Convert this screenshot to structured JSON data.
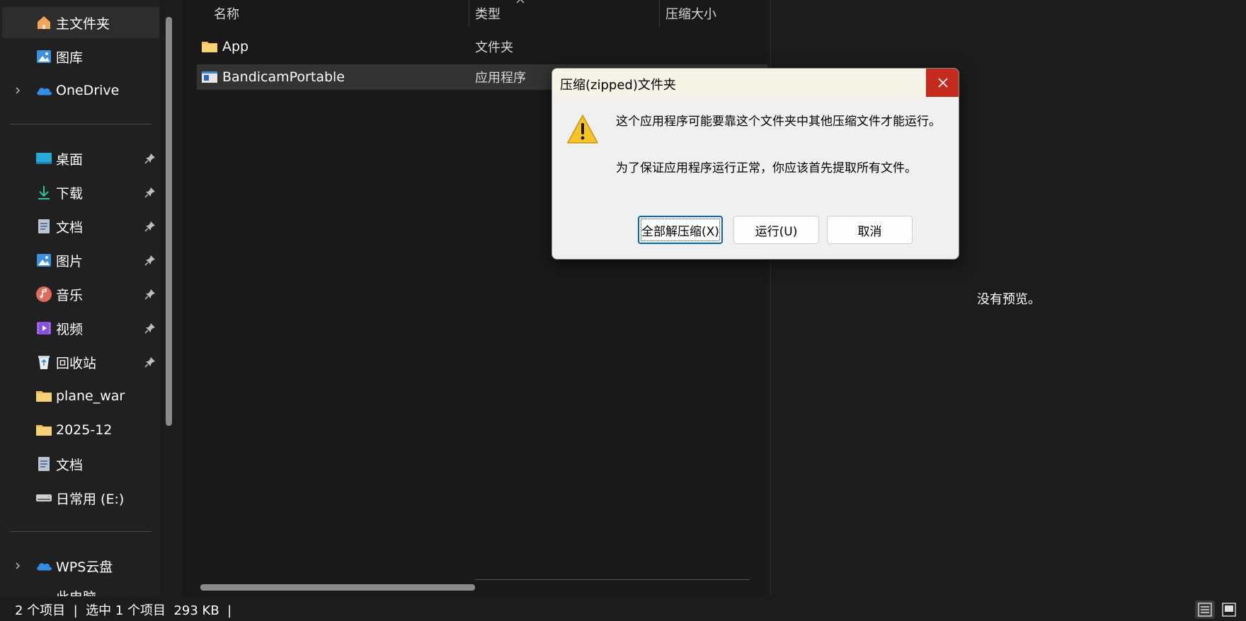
{
  "sidebar": {
    "items": [
      {
        "label": "主文件夹",
        "icon": "home-icon"
      },
      {
        "label": "图库",
        "icon": "gallery-icon"
      },
      {
        "label": "OneDrive",
        "icon": "cloud-icon"
      },
      {
        "label": "桌面",
        "icon": "desktop-icon"
      },
      {
        "label": "下载",
        "icon": "download-icon"
      },
      {
        "label": "文档",
        "icon": "document-icon"
      },
      {
        "label": "图片",
        "icon": "pictures-icon"
      },
      {
        "label": "音乐",
        "icon": "music-icon"
      },
      {
        "label": "视频",
        "icon": "video-icon"
      },
      {
        "label": "回收站",
        "icon": "recycle-bin-icon"
      },
      {
        "label": "plane_war",
        "icon": "folder-icon"
      },
      {
        "label": "2025-12",
        "icon": "folder-icon"
      },
      {
        "label": "文档",
        "icon": "document-icon"
      },
      {
        "label": "日常用 (E:)",
        "icon": "drive-icon"
      },
      {
        "label": "WPS云盘",
        "icon": "cloud-icon"
      },
      {
        "label": "此电脑",
        "icon": "computer-icon"
      }
    ]
  },
  "filelist": {
    "columns": {
      "name": "名称",
      "type": "类型",
      "compressed_size": "压缩大小"
    },
    "rows": [
      {
        "name": "App",
        "type": "文件夹",
        "icon": "folder-icon"
      },
      {
        "name": "BandicamPortable",
        "type": "应用程序",
        "icon": "application-icon"
      }
    ]
  },
  "preview": {
    "empty_text": "没有预览。"
  },
  "statusbar": {
    "text": "2 个项目  |  选中 1 个项目  293 KB  |"
  },
  "dialog": {
    "title": "压缩(zipped)文件夹",
    "message_line1": "这个应用程序可能要靠这个文件夹中其他压缩文件才能运行。",
    "message_line2": "为了保证应用程序运行正常，你应该首先提取所有文件。",
    "buttons": {
      "extract_all": "全部解压缩(X)",
      "run": "运行(U)",
      "cancel": "取消"
    }
  },
  "colors": {
    "dialog_close": "#c42b1c",
    "default_button_border": "#0067c0",
    "folder": "#f2c14e"
  }
}
